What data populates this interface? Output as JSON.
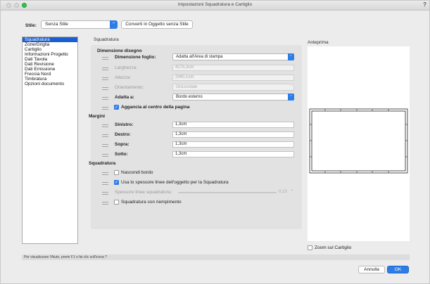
{
  "window": {
    "title": "Impostazioni Squadratura e Cartiglio",
    "help_glyph": "?"
  },
  "style_row": {
    "label": "Stile:",
    "selected": "Senza Stile",
    "convert_button": "Converti in Oggetto senza Stile"
  },
  "sidebar": {
    "selected_index": 0,
    "items": [
      "Squadratura",
      "Zone/Griglia",
      "Cartiglio",
      "Informazioni Progetto",
      "Dati Tavola",
      "Dati Revisione",
      "Dati Emissione",
      "Freccia Nord",
      "Timbratura",
      "Opzioni documento"
    ]
  },
  "main": {
    "section_title": "Squadratura",
    "dimensione": {
      "header": "Dimensione disegno",
      "foglio": {
        "label": "Dimensione foglio:",
        "value": "Adatta all'Area di stampa"
      },
      "larghezza": {
        "label": "Larghezza:",
        "value": "4175,3cm"
      },
      "altezza": {
        "label": "Altezza:",
        "value": "2940,1cm"
      },
      "orientamento": {
        "label": "Orientamento:",
        "value": "Orizzontale"
      },
      "adatta": {
        "label": "Adatta a:",
        "value": "Bordo esterno"
      },
      "aggancia": {
        "label": "Aggancia al centro della pagina",
        "checked": true
      }
    },
    "margini": {
      "header": "Margini",
      "rows": [
        {
          "label": "Sinistro:",
          "value": "1,3cm"
        },
        {
          "label": "Destro:",
          "value": "1,3cm"
        },
        {
          "label": "Sopra:",
          "value": "1,3cm"
        },
        {
          "label": "Sotto:",
          "value": "1,3cm"
        }
      ]
    },
    "squadratura": {
      "header": "Squadratura",
      "nascondi": {
        "label": "Nascondi bordo",
        "checked": false
      },
      "usa_spessore": {
        "label": "Usa lo spessore linee dell'oggetto per la Squadratura",
        "checked": true
      },
      "spessore": {
        "label": "Spessore linee squadratura:",
        "value": "0,13"
      },
      "riempimento": {
        "label": "Squadratura con riempimento",
        "checked": false
      }
    }
  },
  "preview": {
    "title": "Anteprima",
    "zoom_label": "Zoom sul Cartiglio",
    "zoom_checked": false
  },
  "status_text": "Per visualizzare l'Aiuto, premi F1 o fai clic sull'icona ?",
  "buttons": {
    "cancel": "Annulla",
    "ok": "OK"
  },
  "colors": {
    "accent": "#2d7de6",
    "selection": "#1a5fd1",
    "panel": "#e2e2e2"
  }
}
